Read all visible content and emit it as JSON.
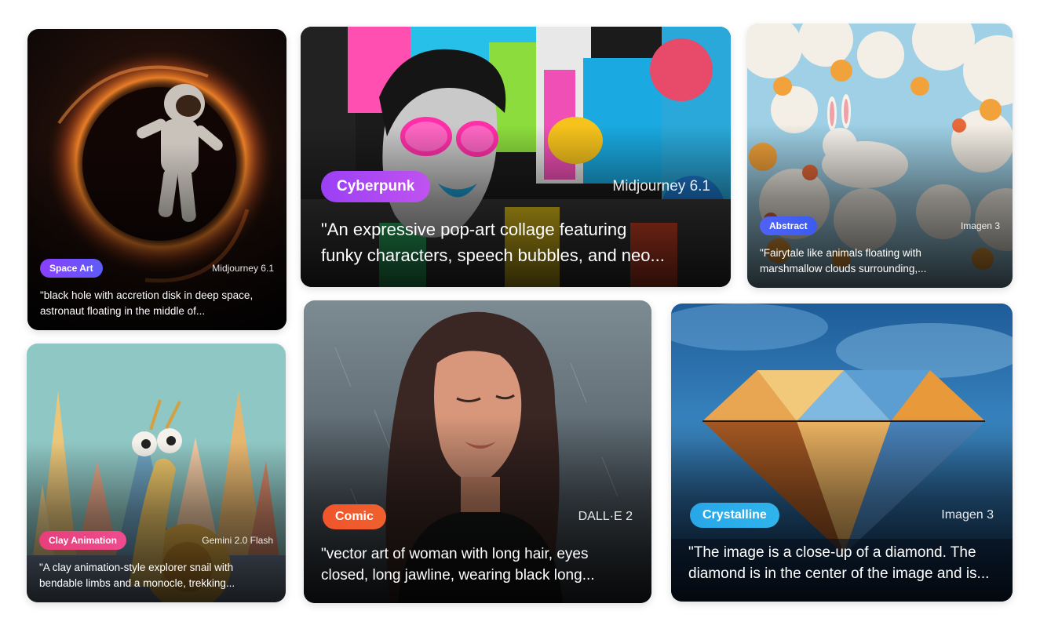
{
  "cards": [
    {
      "tag": "Space Art",
      "model": "Midjourney 6.1",
      "prompt_line1": "\"black hole with accretion disk in deep space,",
      "prompt_line2": "astronaut floating in the middle of...",
      "tag_color": "#7b4af9"
    },
    {
      "tag": "Cyberpunk",
      "model": "Midjourney 6.1",
      "prompt_line1": "\"An expressive pop-art collage featuring",
      "prompt_line2": "funky characters, speech bubbles, and neo...",
      "tag_color": "#a94af3"
    },
    {
      "tag": "Abstract",
      "model": "Imagen 3",
      "prompt_line1": "\"Fairytale like animals floating with",
      "prompt_line2": "marshmallow clouds surrounding,...",
      "tag_color": "#4a5ff3"
    },
    {
      "tag": "Clay Animation",
      "model": "Gemini 2.0 Flash",
      "prompt_line1": "\"A clay animation-style explorer snail with",
      "prompt_line2": "bendable limbs and a monocle, trekking...",
      "tag_color": "#ea4583"
    },
    {
      "tag": "Comic",
      "model": "DALL·E 2",
      "prompt_line1": "\"vector art of woman with long hair, eyes",
      "prompt_line2": "closed, long jawline, wearing black long...",
      "tag_color": "#f0582c"
    },
    {
      "tag": "Crystalline",
      "model": "Imagen 3",
      "prompt_line1": "\"The image is a close-up of a diamond. The",
      "prompt_line2": "diamond is in the center of the image and is...",
      "tag_color": "#2badea"
    }
  ]
}
